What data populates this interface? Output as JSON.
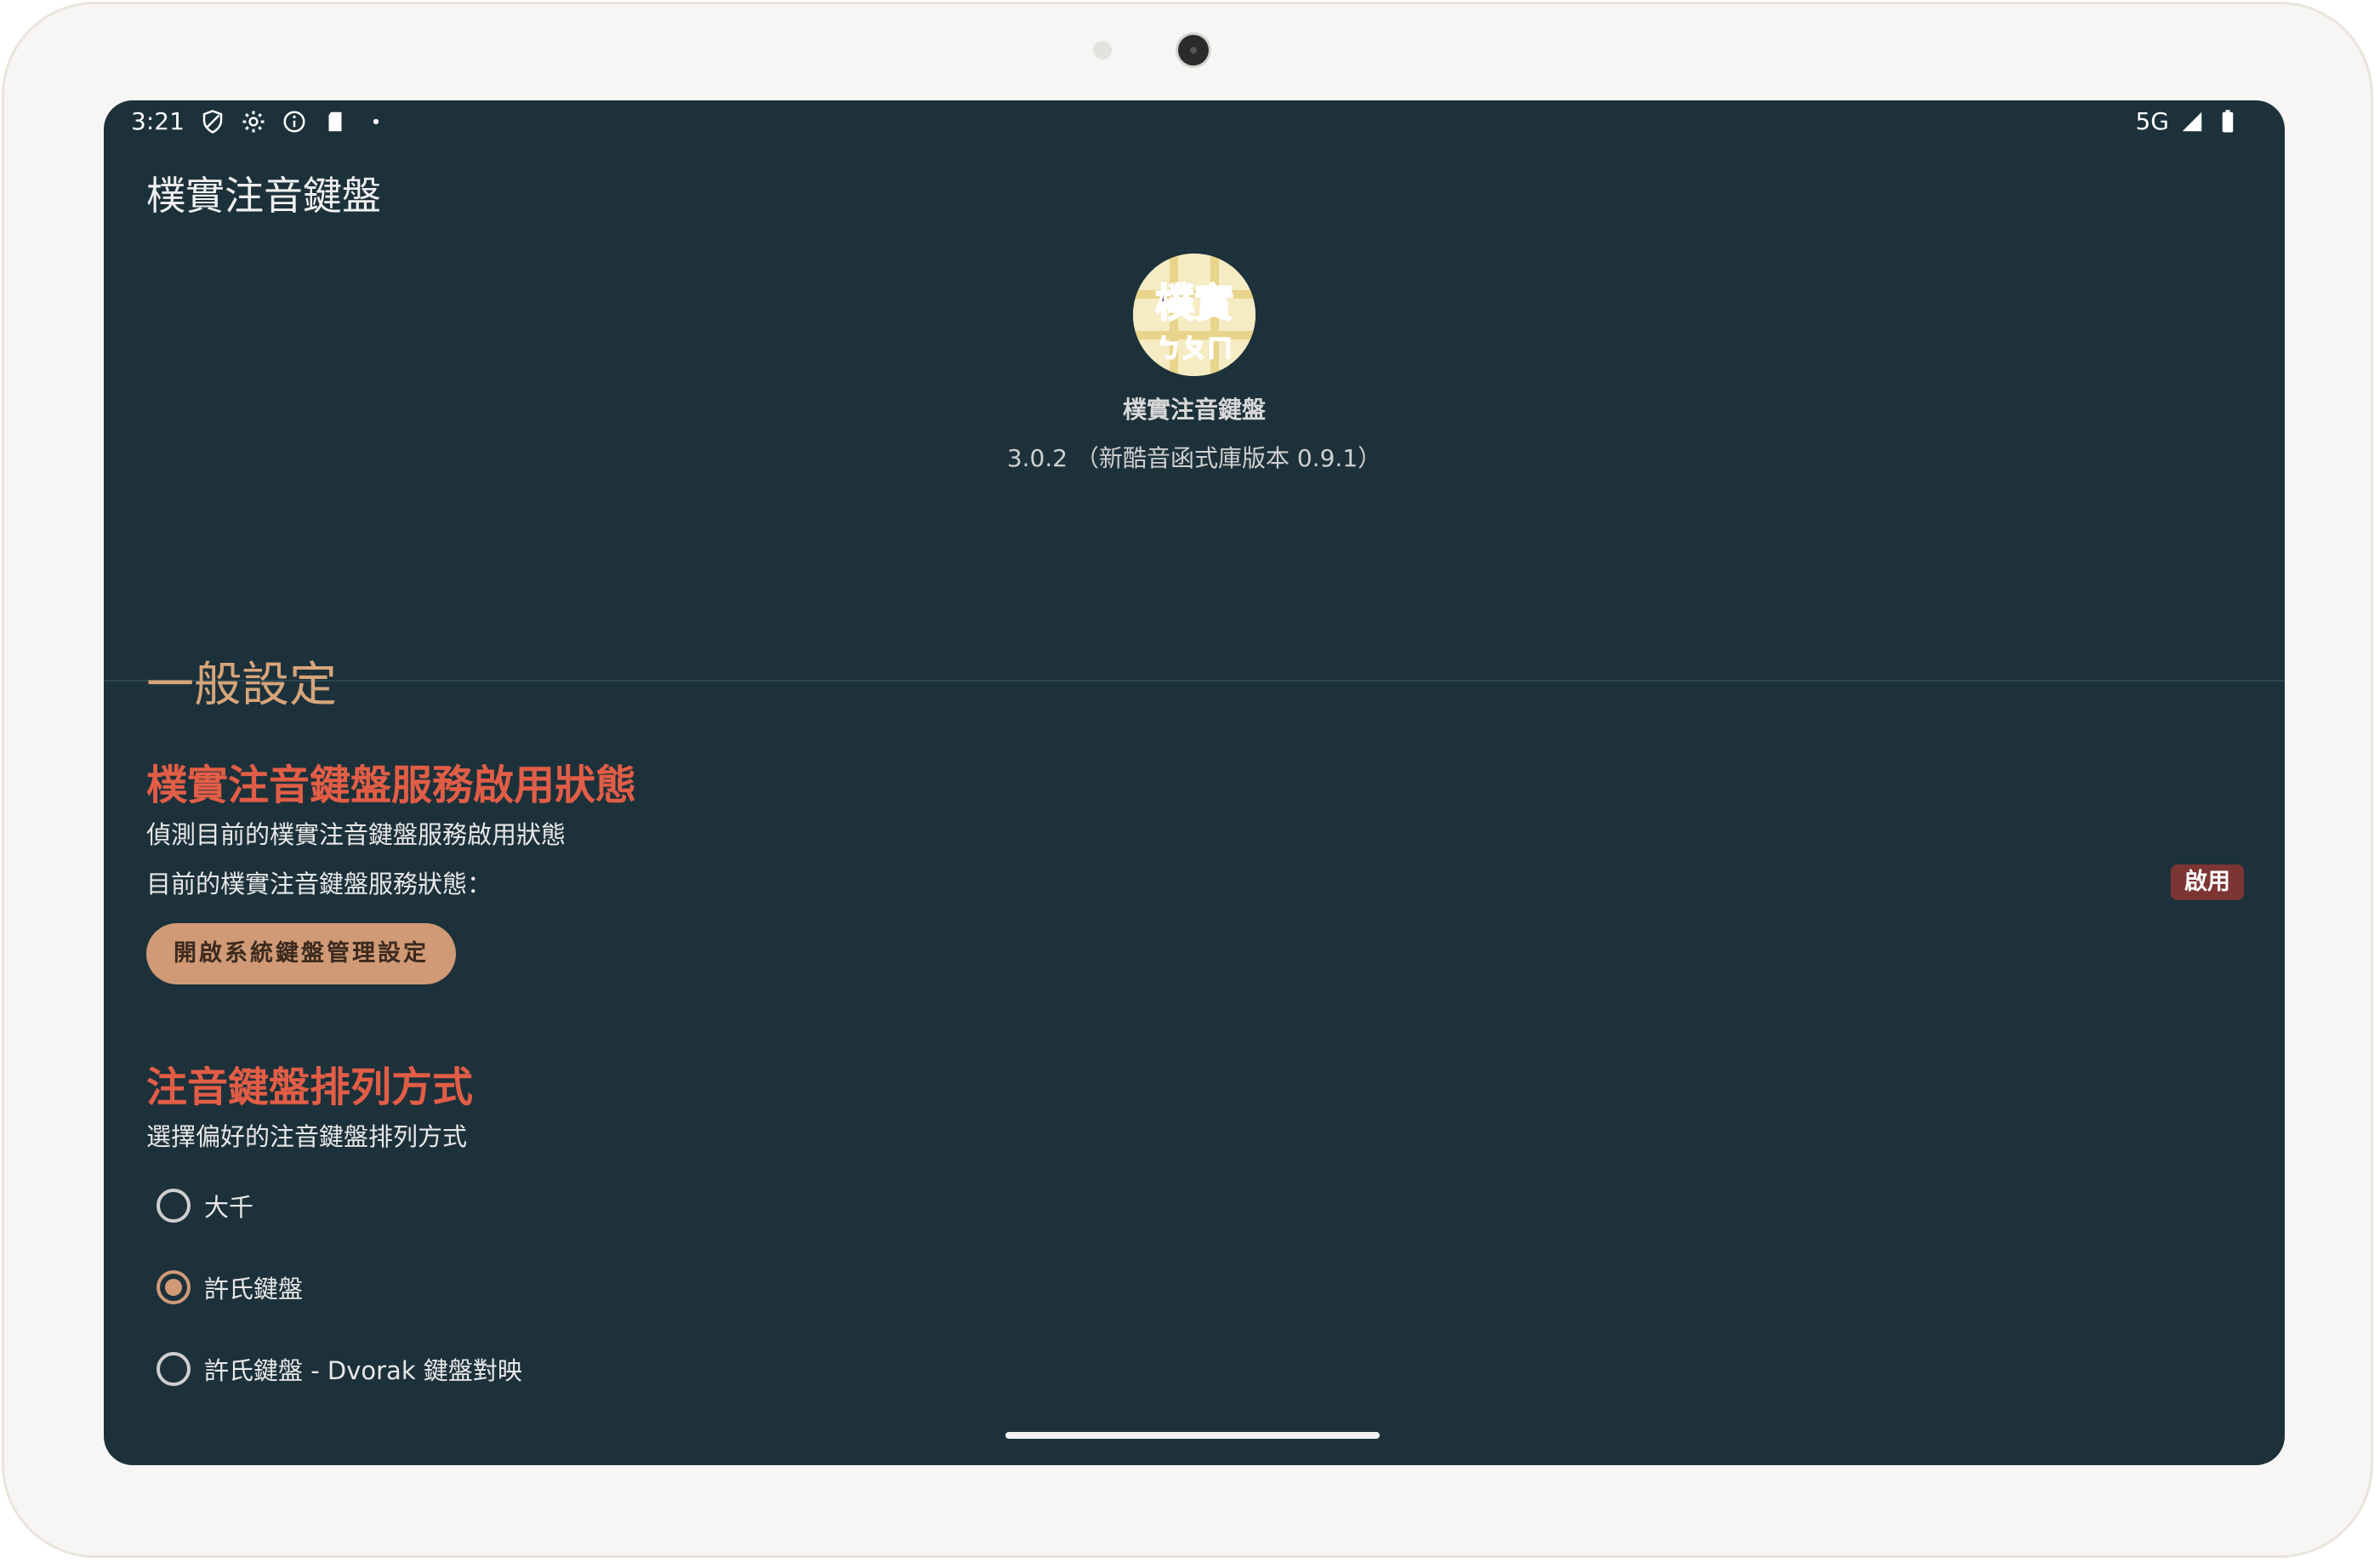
{
  "status_bar": {
    "time": "3:21",
    "left_icons": [
      "shield-icon",
      "settings-icon",
      "info-icon",
      "sd-card-icon",
      "dot-icon"
    ],
    "network": "5G",
    "right_icons": [
      "signal-icon",
      "battery-icon"
    ]
  },
  "app_bar": {
    "title": "樸實注音鍵盤"
  },
  "header": {
    "logo_text_top": "樸實",
    "logo_text_bottom": "ㄅㄆㄇ",
    "app_name": "樸實注音鍵盤",
    "version": "3.0.2 （新酷音函式庫版本 0.9.1）"
  },
  "general_settings": {
    "heading": "一般設定",
    "service_status": {
      "title": "樸實注音鍵盤服務啟用狀態",
      "description": "偵測目前的樸實注音鍵盤服務啟用狀態",
      "current_label": "目前的樸實注音鍵盤服務狀態：",
      "badge": "啟用",
      "badge_color": "#7d3533",
      "button_label": "開啟系統鍵盤管理設定"
    },
    "layout": {
      "title": "注音鍵盤排列方式",
      "description": "選擇偏好的注音鍵盤排列方式",
      "options": [
        {
          "label": "大千",
          "checked": false
        },
        {
          "label": "許氏鍵盤",
          "checked": true
        },
        {
          "label": "許氏鍵盤 - Dvorak 鍵盤對映",
          "checked": false
        }
      ]
    }
  },
  "colors": {
    "background": "#1d313a",
    "section_heading": "#d7a57a",
    "pref_title": "#e25d46",
    "accent": "#d09a76"
  }
}
